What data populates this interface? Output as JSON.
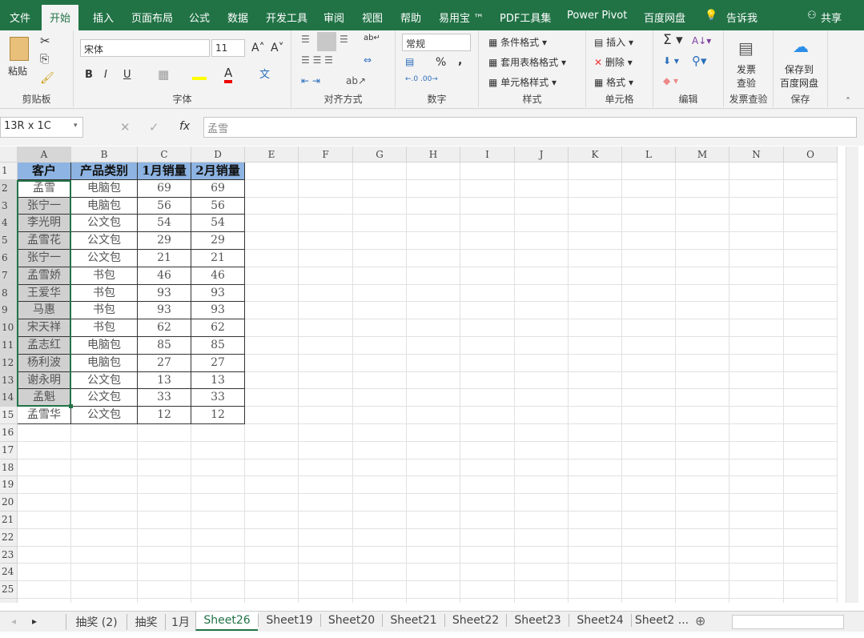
{
  "tabs": [
    "文件",
    "开始",
    "插入",
    "页面布局",
    "公式",
    "数据",
    "开发工具",
    "审阅",
    "视图",
    "帮助",
    "易用宝 ™",
    "PDF工具集",
    "Power Pivot",
    "百度网盘",
    "告诉我",
    "共享"
  ],
  "ribbon": {
    "clipboard": {
      "paste": "粘贴",
      "label": "剪贴板"
    },
    "font": {
      "name": "宋体",
      "size": "11",
      "bold": "B",
      "italic": "I",
      "underline": "U",
      "label": "字体"
    },
    "align": {
      "label": "对齐方式"
    },
    "number": {
      "format": "常规",
      "percent": "%",
      "comma": ",",
      "label": "数字"
    },
    "styles": {
      "cond": "条件格式",
      "table": "套用表格格式",
      "cell": "单元格样式",
      "label": "样式"
    },
    "cells": {
      "insert": "插入",
      "delete": "删除",
      "format": "格式",
      "label": "单元格"
    },
    "edit": {
      "label": "编辑"
    },
    "invoice": {
      "btn": "发票\n查验",
      "label": "发票查验"
    },
    "save": {
      "btn": "保存到\n百度网盘",
      "label": "保存"
    }
  },
  "formula": {
    "namebox": "13R x 1C",
    "fx": "fx",
    "value": "孟雪"
  },
  "columns": [
    "A",
    "B",
    "C",
    "D",
    "E",
    "F",
    "G",
    "H",
    "I",
    "J",
    "K",
    "L",
    "M",
    "N",
    "O"
  ],
  "header": [
    "客户",
    "产品类别",
    "1月销量",
    "2月销量"
  ],
  "rows": [
    [
      "孟雪",
      "电脑包",
      "69",
      "69"
    ],
    [
      "张宁一",
      "电脑包",
      "56",
      "56"
    ],
    [
      "李光明",
      "公文包",
      "54",
      "54"
    ],
    [
      "孟雪花",
      "公文包",
      "29",
      "29"
    ],
    [
      "张宁一",
      "公文包",
      "21",
      "21"
    ],
    [
      "孟雪娇",
      "书包",
      "46",
      "46"
    ],
    [
      "王爱华",
      "书包",
      "93",
      "93"
    ],
    [
      "马惠",
      "书包",
      "93",
      "93"
    ],
    [
      "宋天祥",
      "书包",
      "62",
      "62"
    ],
    [
      "孟志红",
      "电脑包",
      "85",
      "85"
    ],
    [
      "杨利波",
      "电脑包",
      "27",
      "27"
    ],
    [
      "谢永明",
      "公文包",
      "13",
      "13"
    ],
    [
      "孟魁",
      "公文包",
      "33",
      "33"
    ],
    [
      "孟雪华",
      "公文包",
      "12",
      "12"
    ]
  ],
  "sheets": [
    "抽奖 (2)",
    "抽奖",
    "1月",
    "Sheet26",
    "Sheet19",
    "Sheet20",
    "Sheet21",
    "Sheet22",
    "Sheet23",
    "Sheet24",
    "Sheet2 ..."
  ],
  "active_sheet": "Sheet26",
  "colors": {
    "brand": "#217346",
    "header_fill": "#8db4e2",
    "selection": "#d0d0d0"
  }
}
